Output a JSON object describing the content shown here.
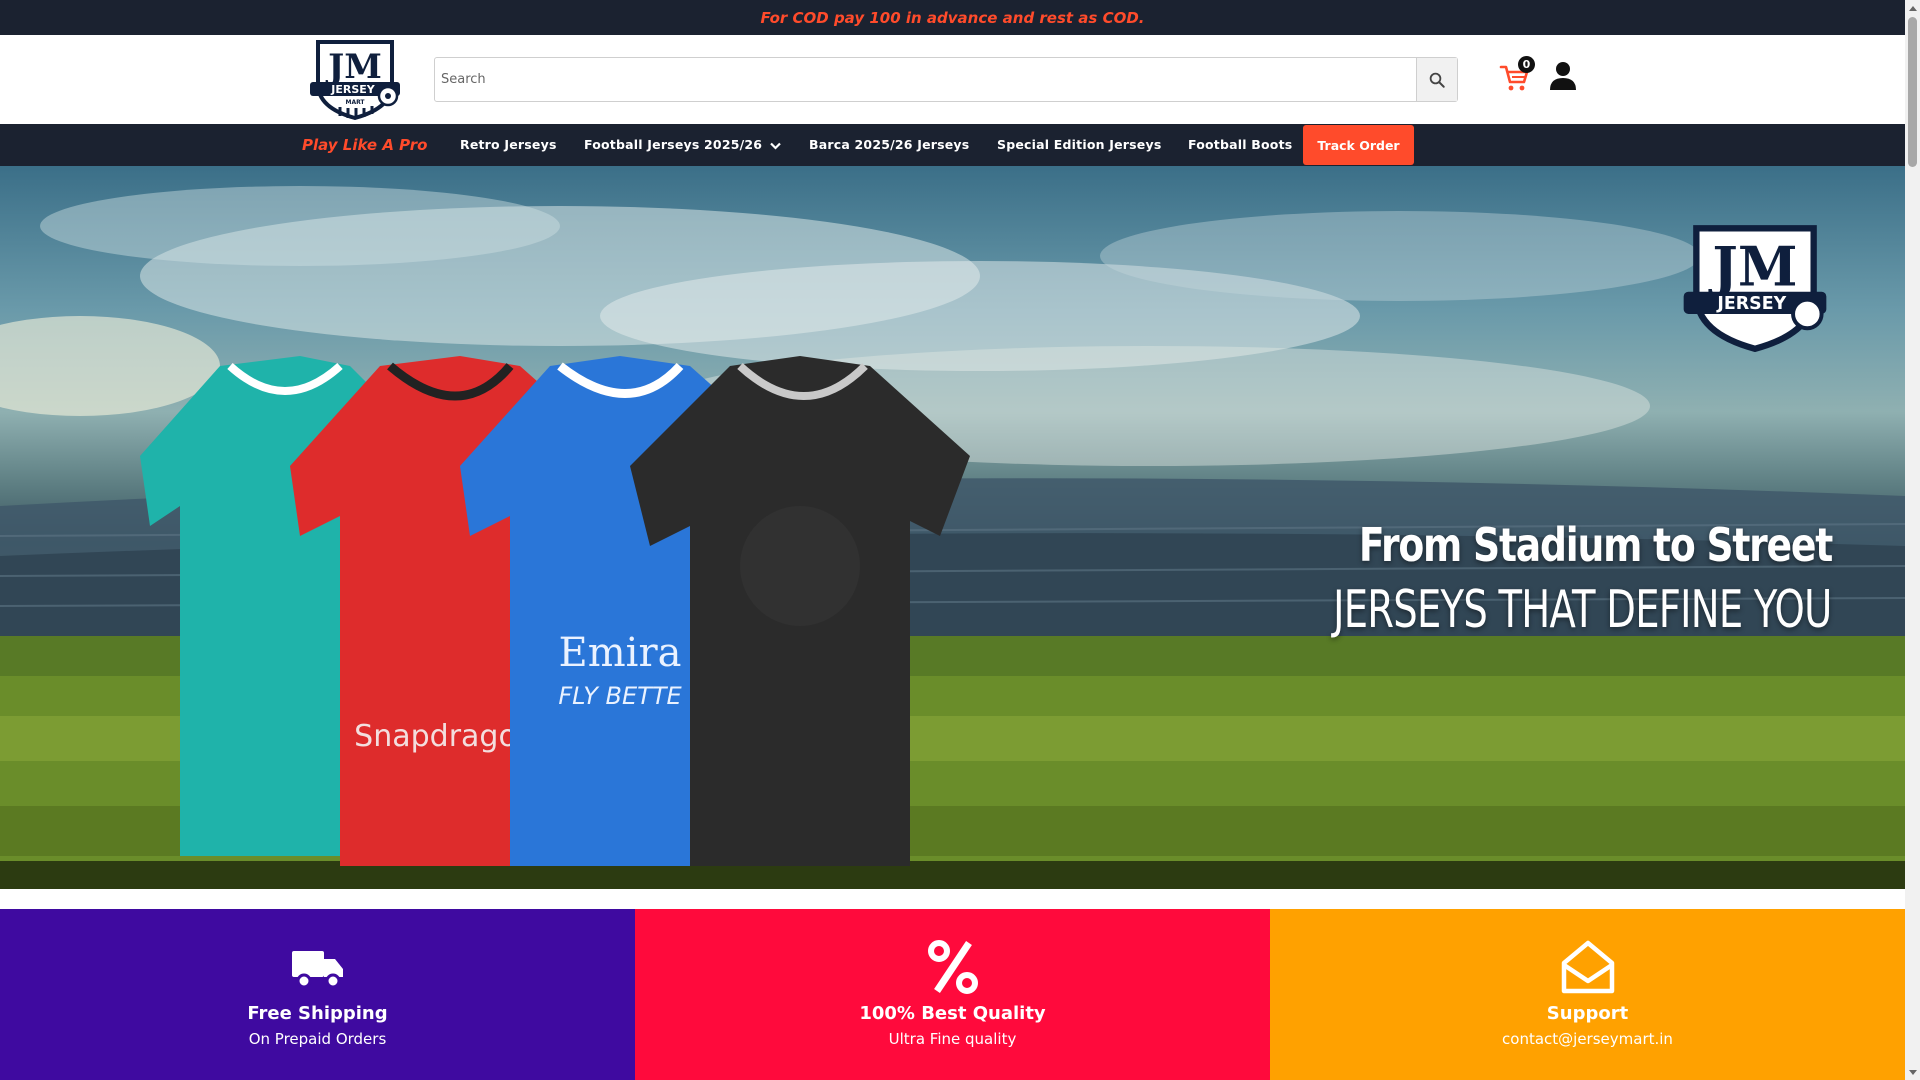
{
  "announcement": {
    "text": "For COD pay 100 in advance and rest as COD."
  },
  "header": {
    "logo": {
      "name": "jersey-mart-logo",
      "lettering": "JM JERSEY MART"
    },
    "search": {
      "placeholder": "Search",
      "value": ""
    },
    "cart": {
      "count": "0"
    }
  },
  "nav": {
    "tagline": "Play Like A Pro",
    "items": [
      {
        "label": "Retro Jerseys"
      },
      {
        "label": "Football Jerseys 2025/26",
        "has_dropdown": true
      },
      {
        "label": "Barca 2025/26 Jerseys"
      },
      {
        "label": "Special Edition Jerseys"
      },
      {
        "label": "Football Boots"
      }
    ],
    "track_order": "Track Order"
  },
  "hero": {
    "headline": "From Stadium to Street",
    "subheadline": "JERSEYS THAT DEFINE YOU",
    "shirt_prints": [
      "Snapdragon",
      "Emira",
      "FLY BETTE"
    ]
  },
  "features": [
    {
      "icon": "truck-icon",
      "title": "Free Shipping",
      "subtitle": "On Prepaid Orders",
      "color": "#3f0aa0"
    },
    {
      "icon": "percent-icon",
      "title": "100% Best Quality",
      "subtitle": "Ultra Fine quality",
      "color": "#ff0a3c"
    },
    {
      "icon": "envelope-open-icon",
      "title": "Support",
      "subtitle": "contact@jerseymart.in",
      "color": "#ffa100"
    }
  ],
  "colors": {
    "dark": "#1b2230",
    "accent": "#ff4b2b"
  }
}
